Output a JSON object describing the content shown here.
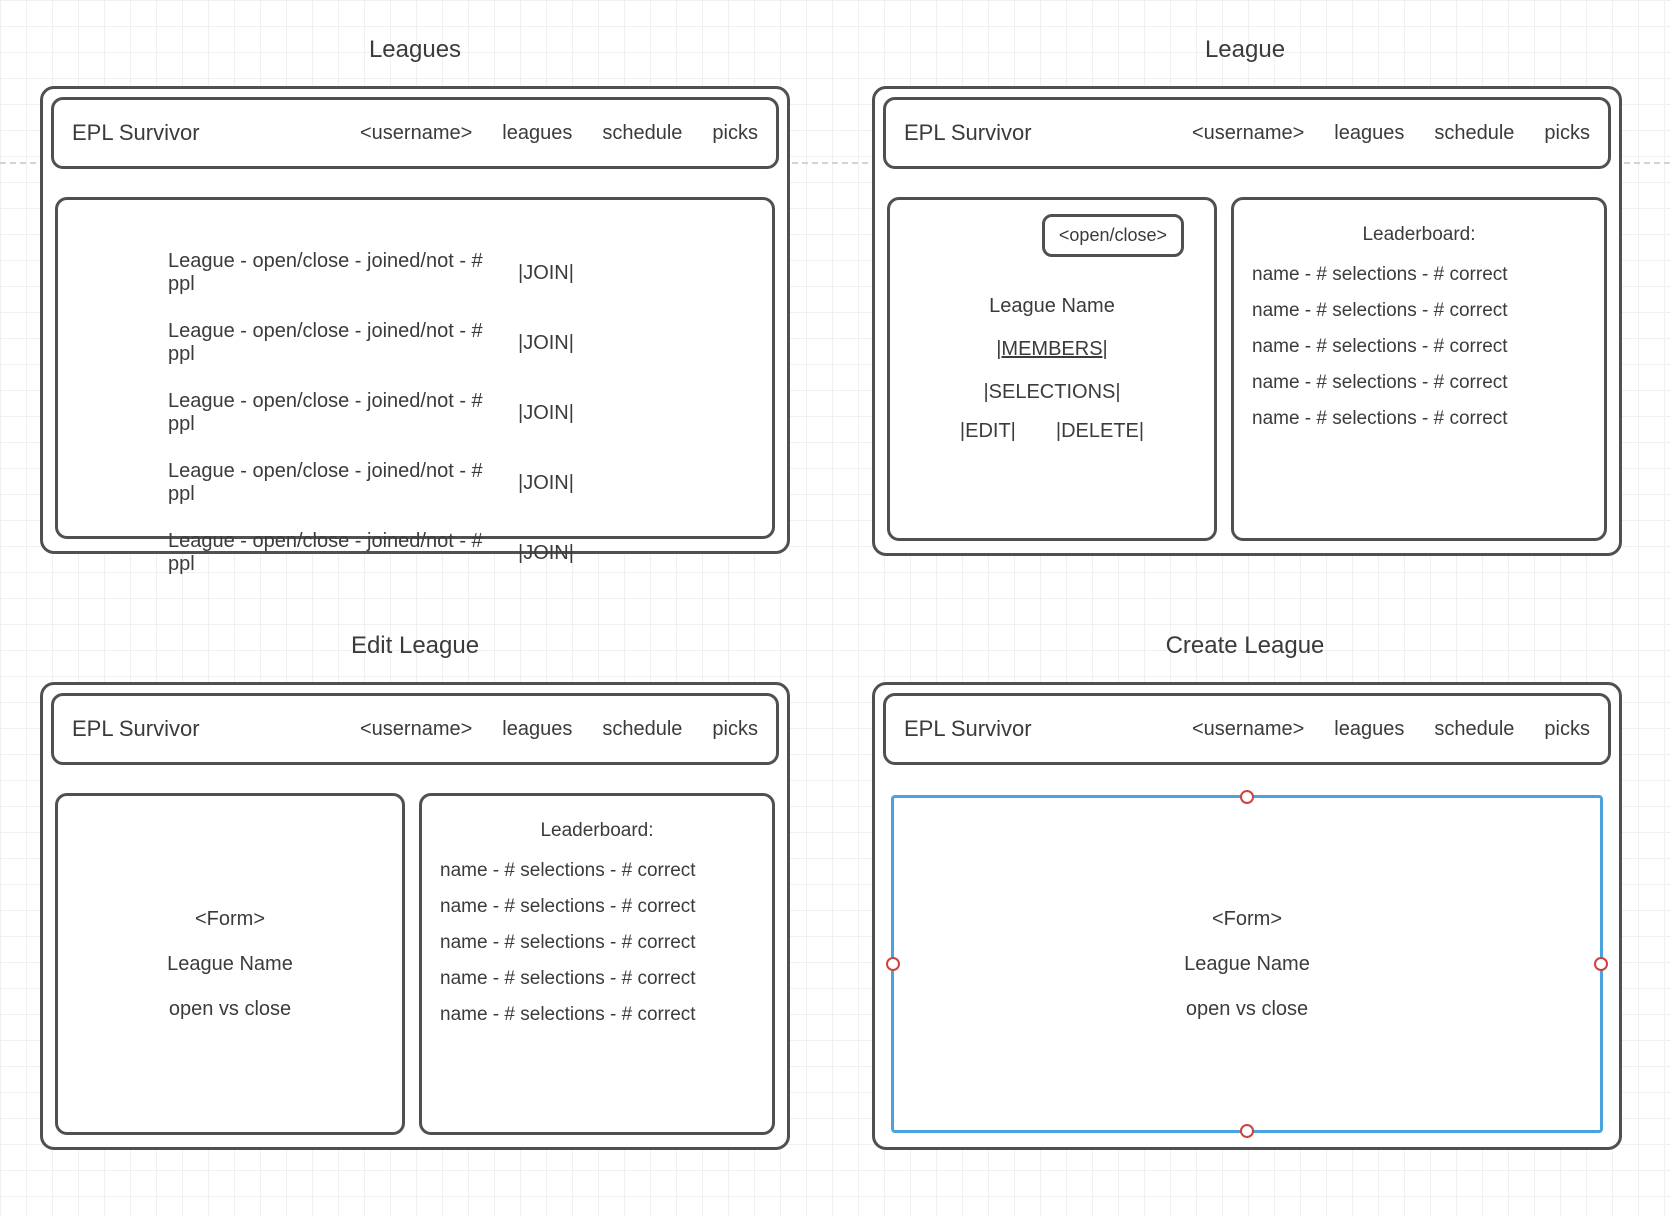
{
  "titles": {
    "leagues": "Leagues",
    "league": "League",
    "edit": "Edit League",
    "create": "Create League"
  },
  "header": {
    "brand": "EPL Survivor",
    "username": "<username>",
    "nav_leagues": "leagues",
    "nav_schedule": "schedule",
    "nav_picks": "picks"
  },
  "leagues_list": {
    "row_label": "League - open/close - joined/not - # ppl",
    "join_label": "|JOIN|",
    "count": 5
  },
  "league_detail": {
    "open_close": "<open/close>",
    "name": "League Name",
    "members": "|MEMBERS|",
    "selections": "|SELECTIONS|",
    "edit": "|EDIT|",
    "delete": "|DELETE|"
  },
  "leaderboard": {
    "title": "Leaderboard:",
    "row_label": "name - # selections - # correct",
    "count": 5
  },
  "form": {
    "heading": "<Form>",
    "name": "League Name",
    "openclose": "open vs close"
  }
}
